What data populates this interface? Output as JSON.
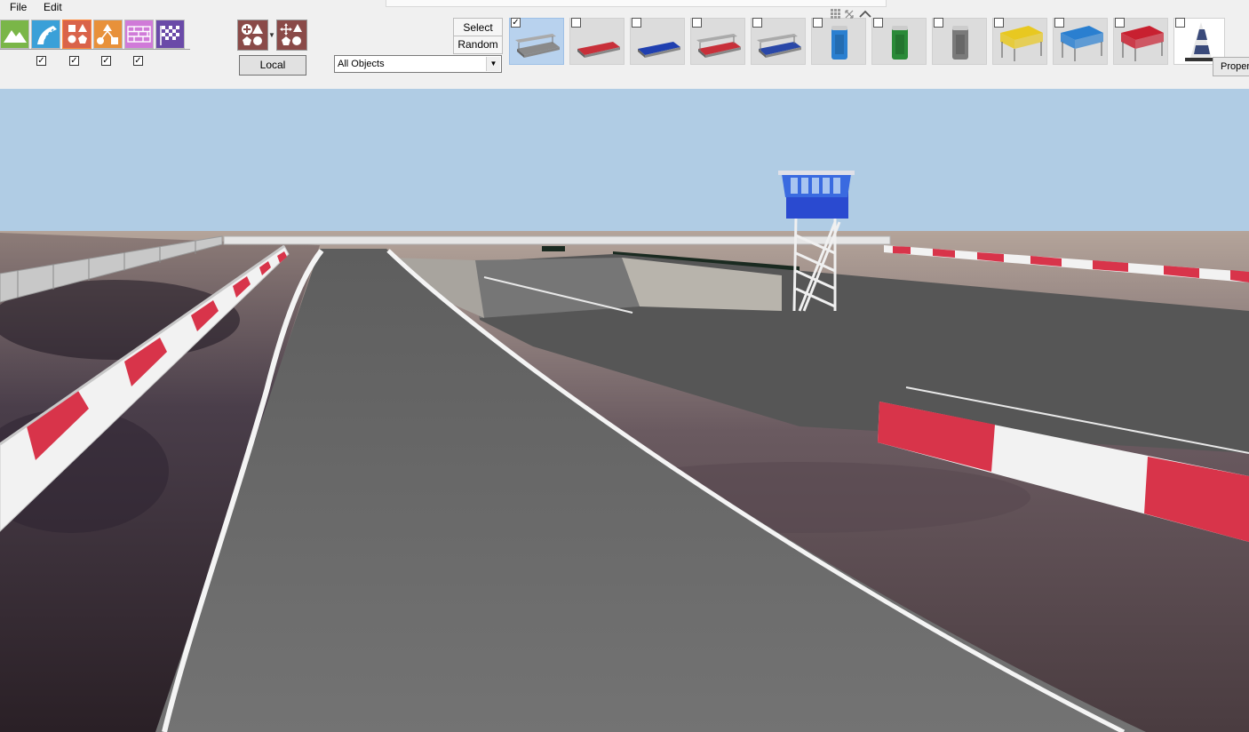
{
  "menu": {
    "file": "File",
    "edit": "Edit"
  },
  "toolbar": {
    "mode_buttons": [
      {
        "icon": "terrain-icon",
        "color": "#7ab648"
      },
      {
        "icon": "road-icon",
        "color": "#3aa0d8"
      },
      {
        "icon": "shapes-icon",
        "color": "#d9634a"
      },
      {
        "icon": "object-network-icon",
        "color": "#e8913a"
      },
      {
        "icon": "wall-icon",
        "color": "#d07ad8"
      },
      {
        "icon": "checkered-flag-icon",
        "color": "#6a4aa8"
      }
    ],
    "layer_checkboxes": [
      "✓",
      "✓",
      "✓",
      "✓"
    ],
    "local_label": "Local",
    "filter_value": "All Objects",
    "select_label": "Select",
    "random_label": "Random",
    "properties_label": "Properties"
  },
  "objects": [
    {
      "name": "grandstand-gray-icon",
      "checked": "✓",
      "selected": true,
      "color": "#8a8a8a"
    },
    {
      "name": "grandstand-red-icon",
      "checked": "",
      "selected": false,
      "color": "#c8303a"
    },
    {
      "name": "grandstand-blue-icon",
      "checked": "",
      "selected": false,
      "color": "#2040b0"
    },
    {
      "name": "grandstand-red-roof-icon",
      "checked": "",
      "selected": false,
      "color": "#c8303a"
    },
    {
      "name": "grandstand-blue-roof-icon",
      "checked": "",
      "selected": false,
      "color": "#2a48a8"
    },
    {
      "name": "portable-toilet-blue-icon",
      "checked": "",
      "selected": false,
      "color": "#2a7fd0"
    },
    {
      "name": "portable-toilet-green-icon",
      "checked": "",
      "selected": false,
      "color": "#2a8a38"
    },
    {
      "name": "portable-toilet-gray-icon",
      "checked": "",
      "selected": false,
      "color": "#7a7a7a"
    },
    {
      "name": "tent-yellow-icon",
      "checked": "",
      "selected": false,
      "color": "#e8c820"
    },
    {
      "name": "tent-blue-icon",
      "checked": "",
      "selected": false,
      "color": "#2a7fd0"
    },
    {
      "name": "tent-red-icon",
      "checked": "",
      "selected": false,
      "color": "#c82030"
    },
    {
      "name": "traffic-cone-icon",
      "checked": "",
      "selected": false,
      "color": "#3a4a7a"
    }
  ],
  "scene": {
    "sky_color": "#b0cce4",
    "asphalt_color": "#6b6b6b",
    "curb_red": "#d8344a",
    "curb_white": "#f2f2f2",
    "tower_color": "#2a4ad0"
  }
}
